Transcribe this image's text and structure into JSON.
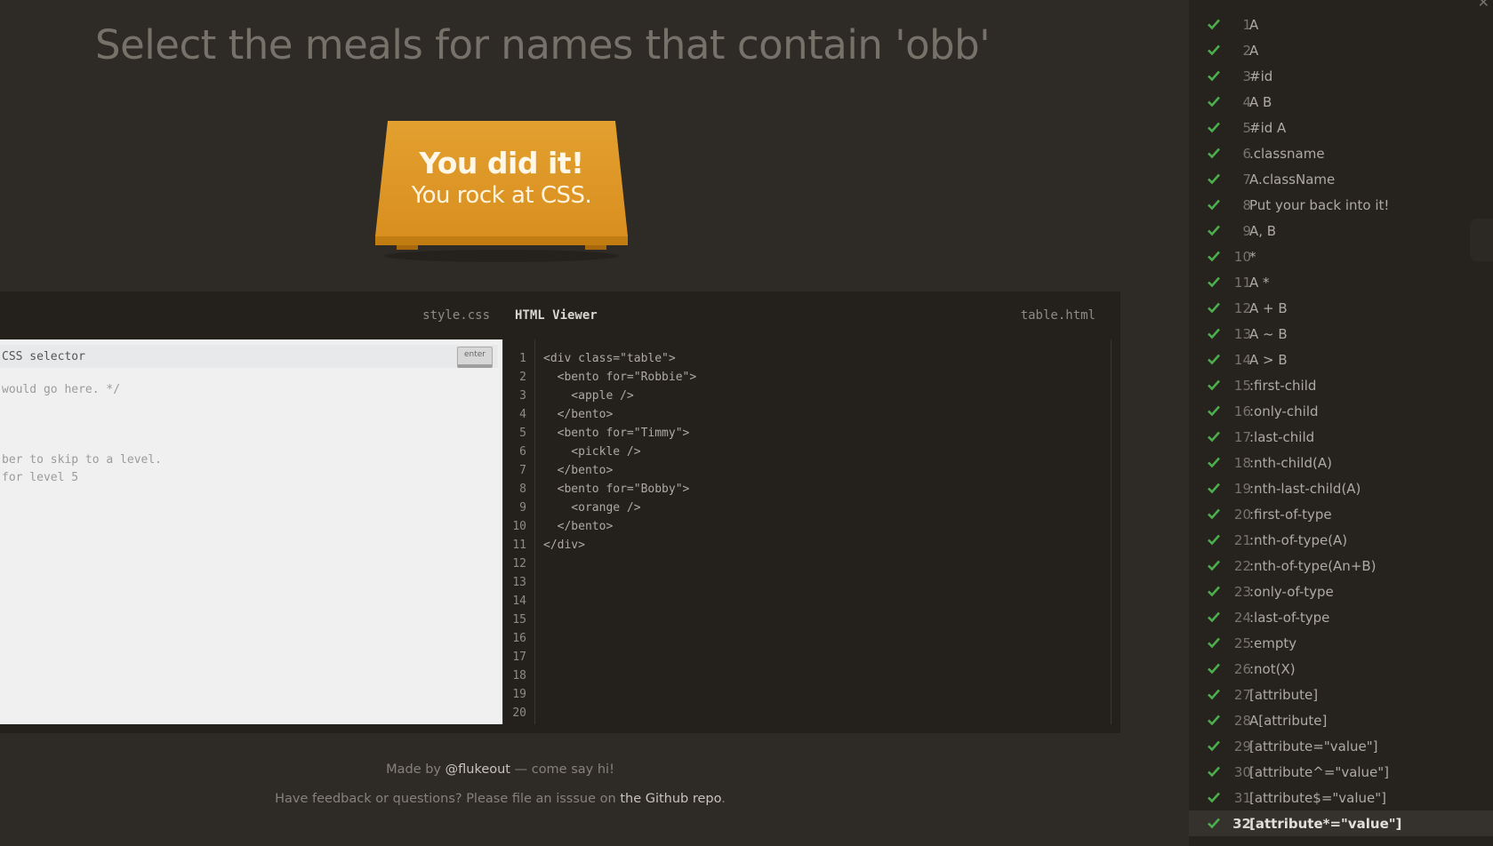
{
  "instruction": "Select the meals for names that contain 'obb'",
  "win": {
    "line1": "You did it!",
    "line2": "You rock at CSS."
  },
  "editor": {
    "css_file": "style.css",
    "html_title": "HTML Viewer",
    "html_file": "table.html",
    "input_placeholder": "CSS selector",
    "enter_label": "enter",
    "css_comments": [
      "would go here. */",
      "ber to skip to a level.",
      "for level 5"
    ],
    "line_numbers": [
      "1",
      "2",
      "3",
      "4",
      "5",
      "6",
      "7",
      "8",
      "9",
      "10",
      "11",
      "12",
      "13",
      "14",
      "15",
      "16",
      "17",
      "18",
      "19",
      "20"
    ],
    "code_lines": [
      "<div class=\"table\">",
      "  <bento for=\"Robbie\">",
      "    <apple />",
      "  </bento>",
      "  <bento for=\"Timmy\">",
      "    <pickle />",
      "  </bento>",
      "  <bento for=\"Bobby\">",
      "    <orange />",
      "  </bento>",
      "</div>"
    ]
  },
  "footer": {
    "made_by_prefix": "Made by ",
    "made_by_link": "@flukeout",
    "made_by_suffix": " — come say hi!",
    "feedback_prefix": "Have feedback or questions? Please file an isssue on ",
    "feedback_link": "the Github repo",
    "feedback_suffix": "."
  },
  "sidebar": {
    "close_icon": "close-icon",
    "check_color": "#4cae4c",
    "current_level": 32,
    "levels": [
      {
        "num": "1",
        "name": "A"
      },
      {
        "num": "2",
        "name": "A"
      },
      {
        "num": "3",
        "name": "#id"
      },
      {
        "num": "4",
        "name": "A  B"
      },
      {
        "num": "5",
        "name": "#id  A"
      },
      {
        "num": "6",
        "name": ".classname"
      },
      {
        "num": "7",
        "name": "A.className"
      },
      {
        "num": "8",
        "name": "Put your back into it!"
      },
      {
        "num": "9",
        "name": "A, B"
      },
      {
        "num": "10",
        "name": "*"
      },
      {
        "num": "11",
        "name": "A  *"
      },
      {
        "num": "12",
        "name": "A + B"
      },
      {
        "num": "13",
        "name": "A ~ B"
      },
      {
        "num": "14",
        "name": "A > B"
      },
      {
        "num": "15",
        "name": ":first-child"
      },
      {
        "num": "16",
        "name": ":only-child"
      },
      {
        "num": "17",
        "name": ":last-child"
      },
      {
        "num": "18",
        "name": ":nth-child(A)"
      },
      {
        "num": "19",
        "name": ":nth-last-child(A)"
      },
      {
        "num": "20",
        "name": ":first-of-type"
      },
      {
        "num": "21",
        "name": ":nth-of-type(A)"
      },
      {
        "num": "22",
        "name": ":nth-of-type(An+B)"
      },
      {
        "num": "23",
        "name": ":only-of-type"
      },
      {
        "num": "24",
        "name": ":last-of-type"
      },
      {
        "num": "25",
        "name": ":empty"
      },
      {
        "num": "26",
        "name": ":not(X)"
      },
      {
        "num": "27",
        "name": "[attribute]"
      },
      {
        "num": "28",
        "name": "A[attribute]"
      },
      {
        "num": "29",
        "name": "[attribute=\"value\"]"
      },
      {
        "num": "30",
        "name": "[attribute^=\"value\"]"
      },
      {
        "num": "31",
        "name": "[attribute$=\"value\"]"
      },
      {
        "num": "32",
        "name": "[attribute*=\"value\"]"
      }
    ]
  }
}
